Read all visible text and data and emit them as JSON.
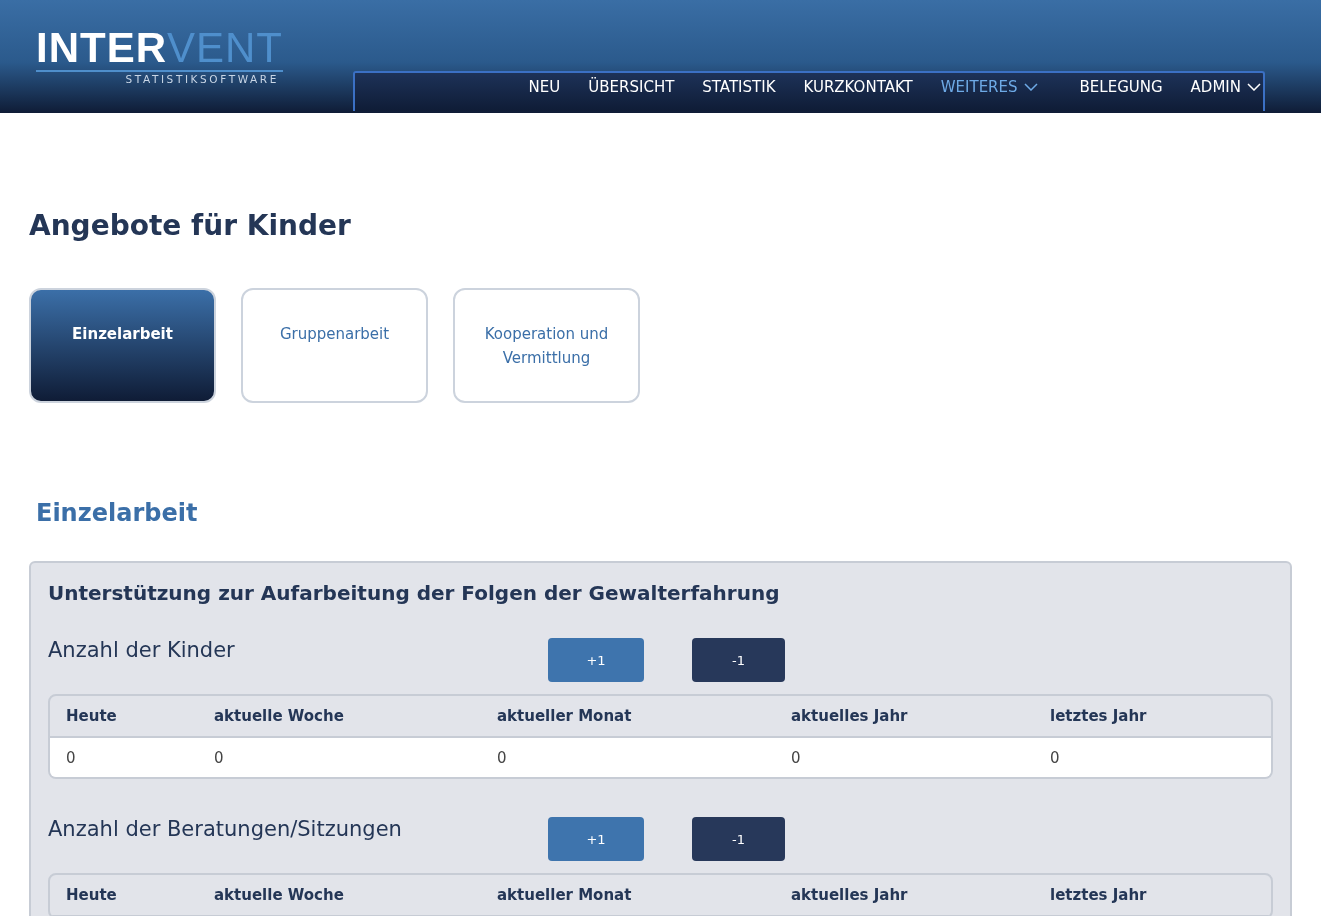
{
  "logo": {
    "part_1": "INTER",
    "part_2": "VENT",
    "tagline": "STATISTIKSOFTWARE"
  },
  "nav": [
    {
      "label": "NEU",
      "selected": false,
      "dropdown": false
    },
    {
      "label": "ÜBERSICHT",
      "selected": false,
      "dropdown": false
    },
    {
      "label": "STATISTIK",
      "selected": false,
      "dropdown": false
    },
    {
      "label": "KURZKONTAKT",
      "selected": false,
      "dropdown": false
    },
    {
      "label": "WEITERES",
      "selected": true,
      "dropdown": true
    },
    {
      "label": "BELEGUNG",
      "selected": false,
      "dropdown": false
    },
    {
      "label": "ADMIN",
      "selected": false,
      "dropdown": true
    }
  ],
  "page_title": "Angebote für Kinder",
  "tiles": [
    {
      "label": "Einzelarbeit",
      "selected": true
    },
    {
      "label": "Gruppenarbeit",
      "selected": false
    },
    {
      "label": "Kooperation und Vermittlung",
      "selected": false
    }
  ],
  "section_title": "Einzelarbeit",
  "panel": {
    "title": "Unterstützung zur Aufarbeitung der Folgen der Gewalterfahrung",
    "counters": [
      {
        "label": "Anzahl der Kinder",
        "plus": "+1",
        "minus": "-1",
        "columns": [
          "Heute",
          "aktuelle Woche",
          "aktueller Monat",
          "aktuelles Jahr",
          "letztes Jahr"
        ],
        "values": [
          "0",
          "0",
          "0",
          "0",
          "0"
        ]
      },
      {
        "label": "Anzahl der Beratungen/Sitzungen",
        "plus": "+1",
        "minus": "-1",
        "columns": [
          "Heute",
          "aktuelle Woche",
          "aktueller Monat",
          "aktuelles Jahr",
          "letztes Jahr"
        ]
      }
    ]
  }
}
